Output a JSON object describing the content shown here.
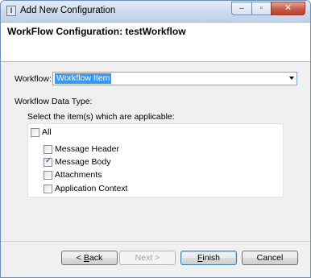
{
  "window": {
    "title": "Add New Configuration",
    "icon": "app-icon",
    "caption_buttons": {
      "minimize": "–",
      "maximize": "▫",
      "close": "✕"
    }
  },
  "header": {
    "title": "WorkFlow Configuration: testWorkflow"
  },
  "workflow": {
    "label": "Workflow:",
    "selected": "Workflow Item"
  },
  "data_type": {
    "label": "Workflow Data Type:",
    "instruction": "Select the item(s) which are applicable:",
    "items": [
      {
        "label": "All",
        "checked": false
      },
      {
        "label": "Message Header",
        "checked": false
      },
      {
        "label": "Message Body",
        "checked": true
      },
      {
        "label": "Attachments",
        "checked": false
      },
      {
        "label": "Application Context",
        "checked": false
      }
    ]
  },
  "buttons": {
    "back": {
      "prefix": "< ",
      "mnemonic": "B",
      "rest": "ack"
    },
    "next": {
      "label": "Next >"
    },
    "finish": {
      "mnemonic": "F",
      "rest": "inish"
    },
    "cancel": {
      "label": "Cancel"
    }
  },
  "colors": {
    "selection": "#3399ff",
    "titlebar": "#c9daee",
    "close_button": "#c75a47"
  }
}
